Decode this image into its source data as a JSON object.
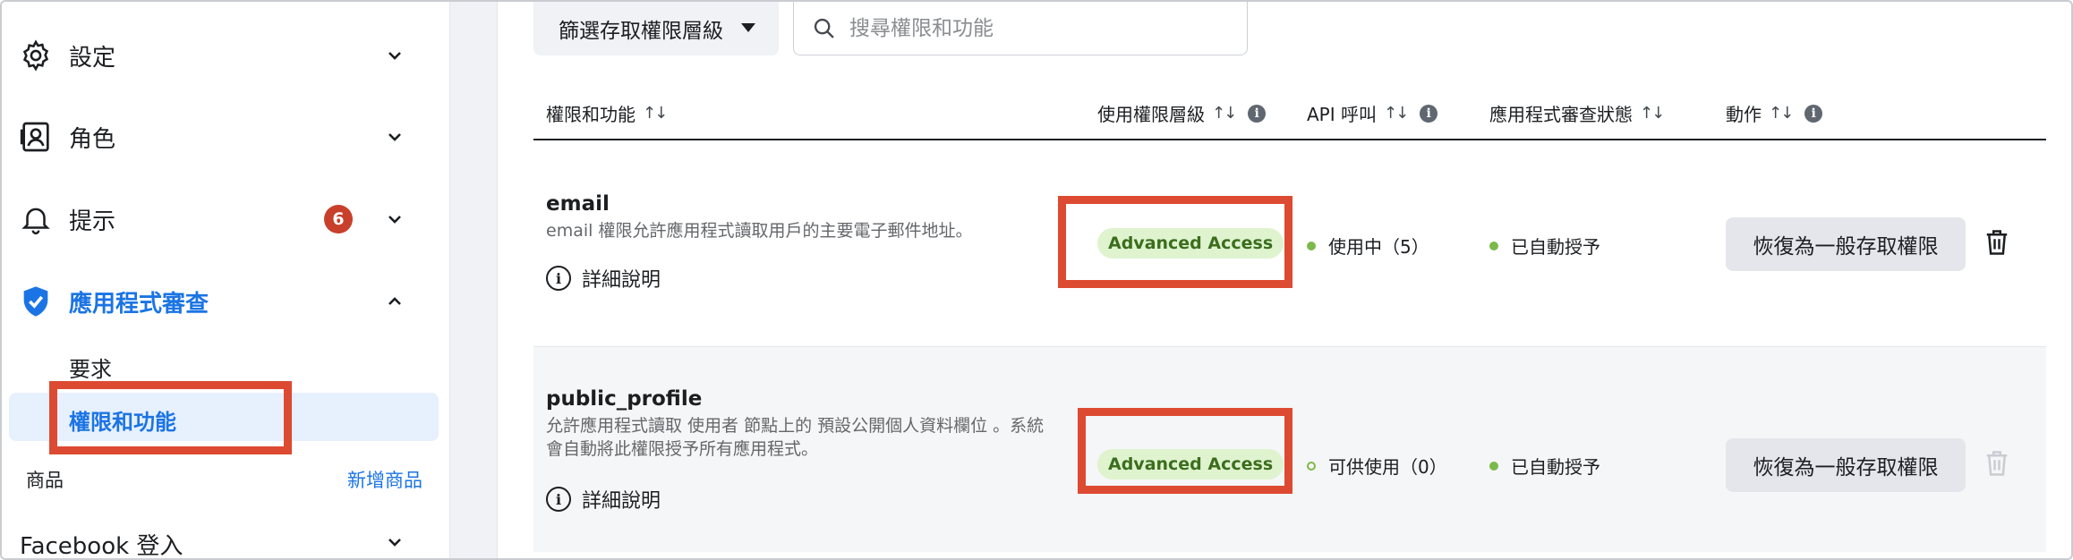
{
  "sidebar": {
    "items": [
      {
        "label": "設定",
        "icon": "gear-icon"
      },
      {
        "label": "角色",
        "icon": "user-card-icon"
      },
      {
        "label": "提示",
        "icon": "bell-icon",
        "badge": "6"
      },
      {
        "label": "應用程式審查",
        "icon": "shield-check-icon"
      }
    ],
    "sub_items": [
      {
        "label": "要求"
      },
      {
        "label": "權限和功能"
      }
    ],
    "section_title": "商品",
    "section_link": "新增商品",
    "facebook_login": "Facebook 登入"
  },
  "toolbar": {
    "filter_label": "篩選存取權限層級",
    "search_placeholder": "搜尋權限和功能"
  },
  "table": {
    "headers": {
      "permission": "權限和功能",
      "access_level": "使用權限層級",
      "api_calls": "API 呼叫",
      "review_status": "應用程式審查狀態",
      "actions": "動作"
    },
    "rows": [
      {
        "name": "email",
        "description": "email 權限允許應用程式讀取用戶的主要電子郵件地址。",
        "details_label": "詳細說明",
        "access_level": "Advanced Access",
        "api_status": "使用中（5）",
        "review_status": "已自動授予",
        "action_label": "恢復為一般存取權限"
      },
      {
        "name": "public_profile",
        "description_line1": "允許應用程式讀取 使用者 節點上的 預設公開個人資料欄位 。系統",
        "description_line2": "會自動將此權限授予所有應用程式。",
        "details_label": "詳細說明",
        "access_level": "Advanced Access",
        "api_status": "可供使用（0）",
        "review_status": "已自動授予",
        "action_label": "恢復為一般存取權限"
      }
    ]
  },
  "colors": {
    "accent": "#1b74e4",
    "highlight": "#dd4a32",
    "badge": "#c8402b",
    "status_green": "#7bb94a",
    "pill_bg": "#dff3cf"
  }
}
